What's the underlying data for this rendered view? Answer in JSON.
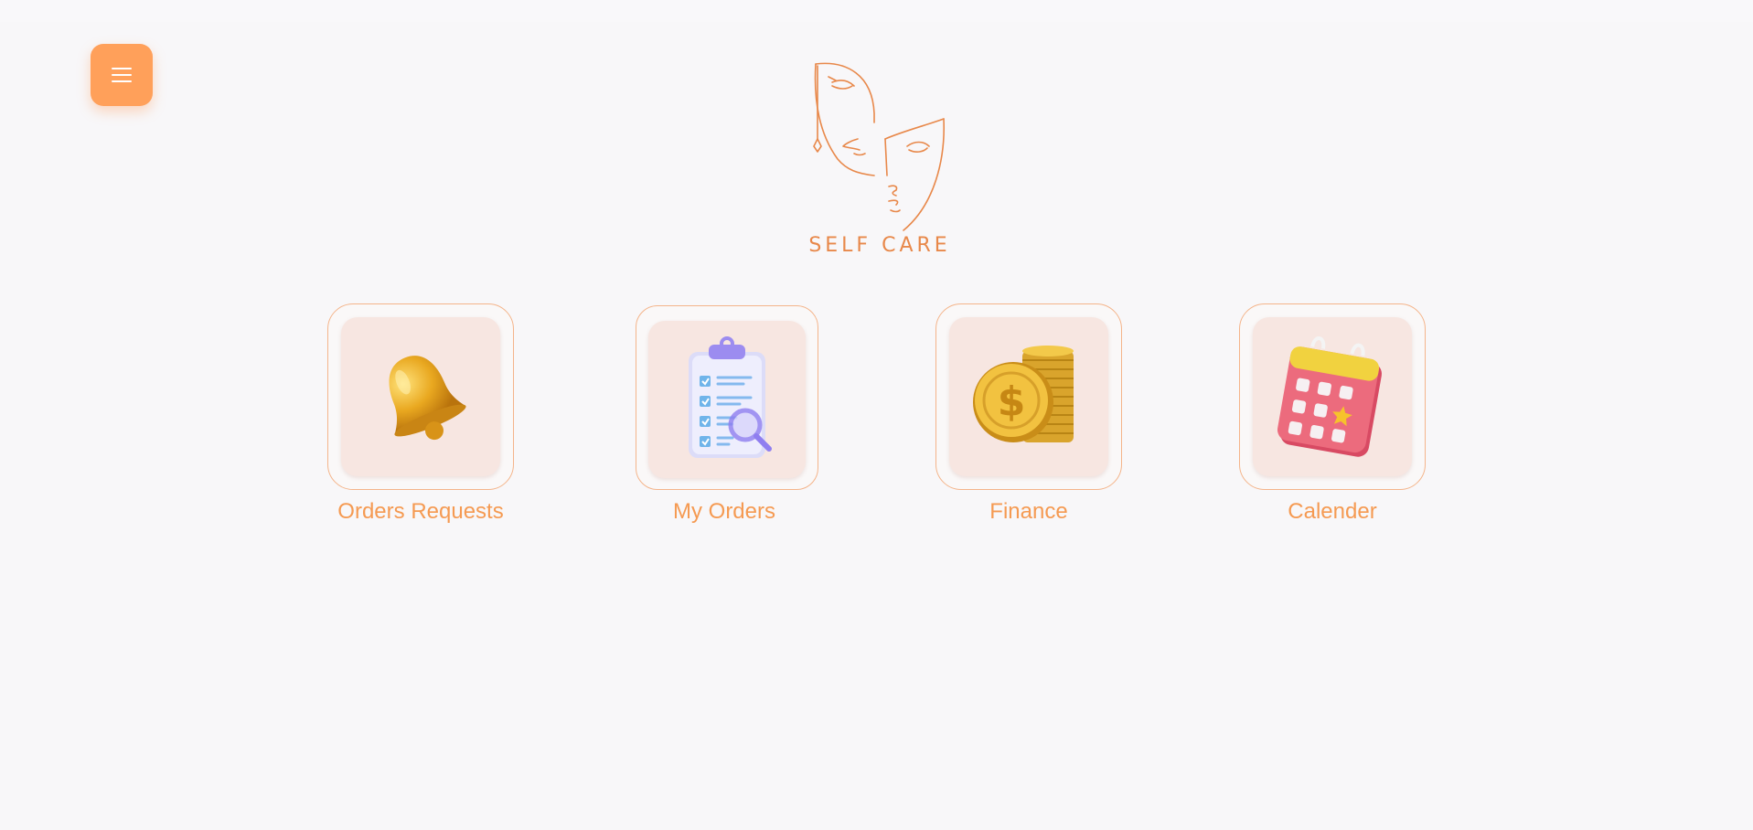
{
  "header": {
    "menu_icon": "hamburger-menu-icon",
    "logo_text": "SELF CARE",
    "accent_color": "#ffa05a"
  },
  "tiles": [
    {
      "label": "Orders Requests",
      "icon": "bell-icon"
    },
    {
      "label": "My Orders",
      "icon": "clipboard-search-icon"
    },
    {
      "label": "Finance",
      "icon": "coins-dollar-icon"
    },
    {
      "label": "Calender",
      "icon": "calendar-star-icon"
    }
  ]
}
